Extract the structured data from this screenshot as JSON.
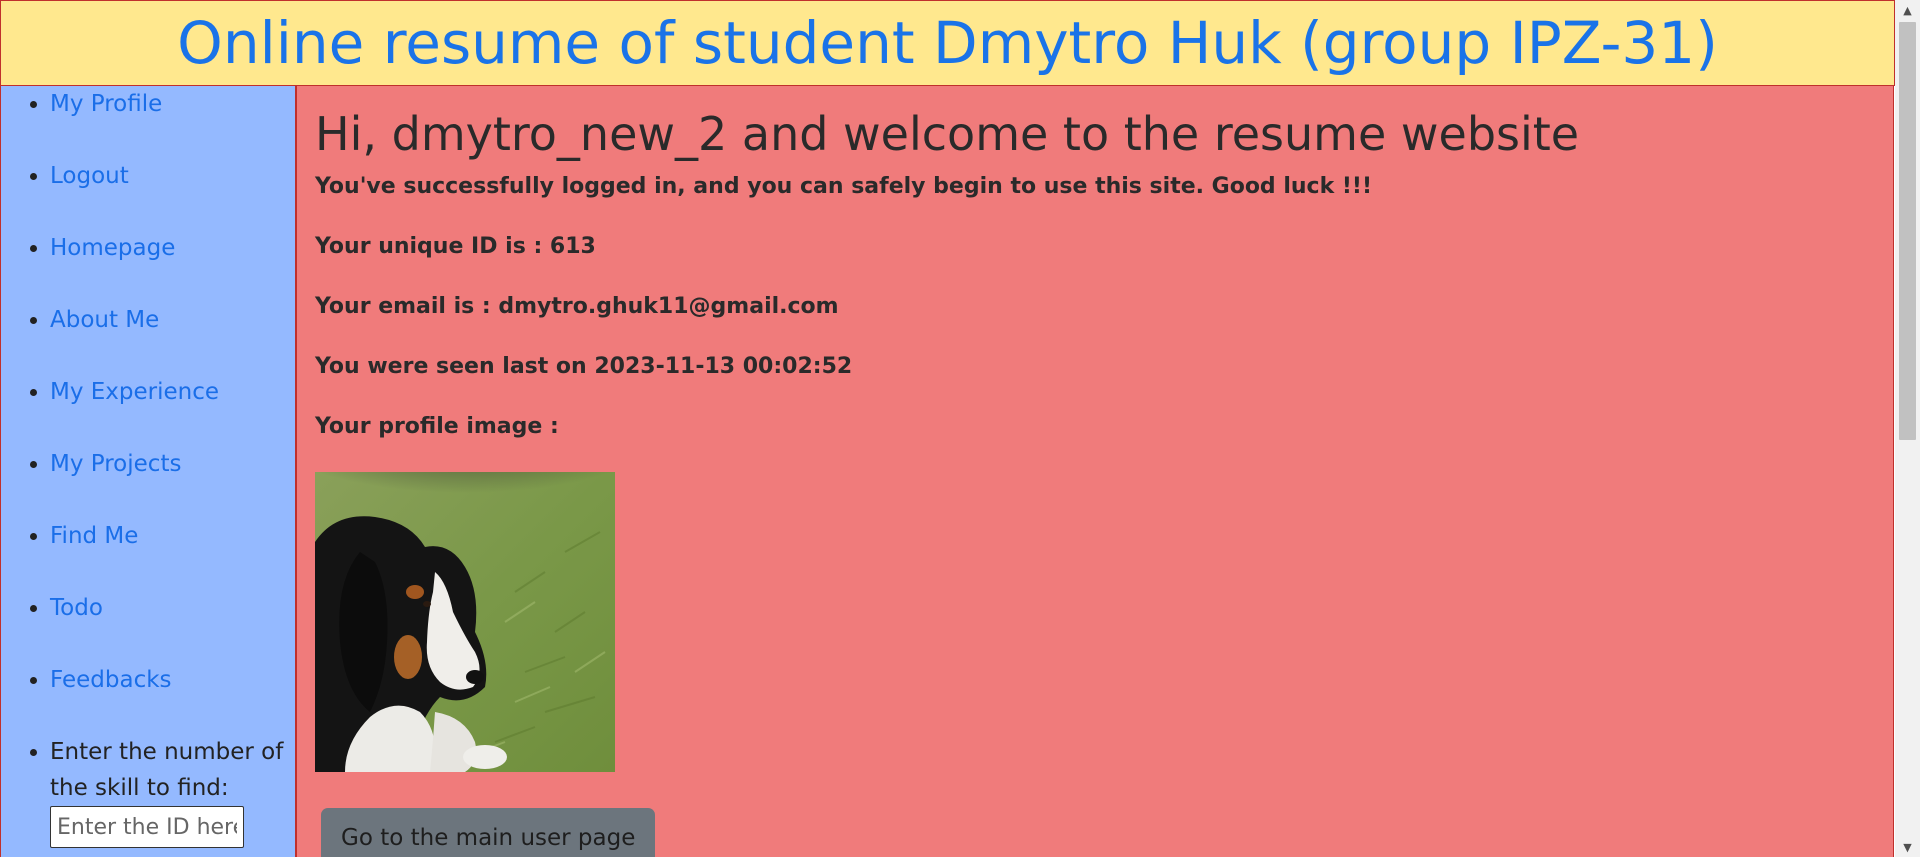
{
  "header": {
    "title": "Online resume of student Dmytro Huk (group IPZ-31)"
  },
  "sidebar": {
    "items": [
      {
        "label": "My Profile"
      },
      {
        "label": "Logout"
      },
      {
        "label": "Homepage"
      },
      {
        "label": "About Me"
      },
      {
        "label": "My Experience"
      },
      {
        "label": "My Projects"
      },
      {
        "label": "Find Me"
      },
      {
        "label": "Todo"
      },
      {
        "label": "Feedbacks"
      }
    ],
    "search": {
      "label": "Enter the number of the skill to find:",
      "placeholder": "Enter the ID here"
    }
  },
  "main": {
    "greeting": "Hi, dmytro_new_2 and welcome to the resume website",
    "success_message": "You've successfully logged in, and you can safely begin to use this site. Good luck !!!",
    "unique_id": "Your unique ID is : 613",
    "email": "Your email is : dmytro.ghuk11@gmail.com",
    "last_seen": "You were seen last on 2023-11-13 00:02:52",
    "profile_image_label": "Your profile image :",
    "main_page_button": "Go to the main user page"
  },
  "colors": {
    "header_bg": "#ffe88e",
    "header_text": "#1a73e8",
    "sidebar_bg": "#94b9ff",
    "main_bg": "#f07b7b",
    "border": "#c0302c",
    "button_bg": "#6c757d"
  }
}
